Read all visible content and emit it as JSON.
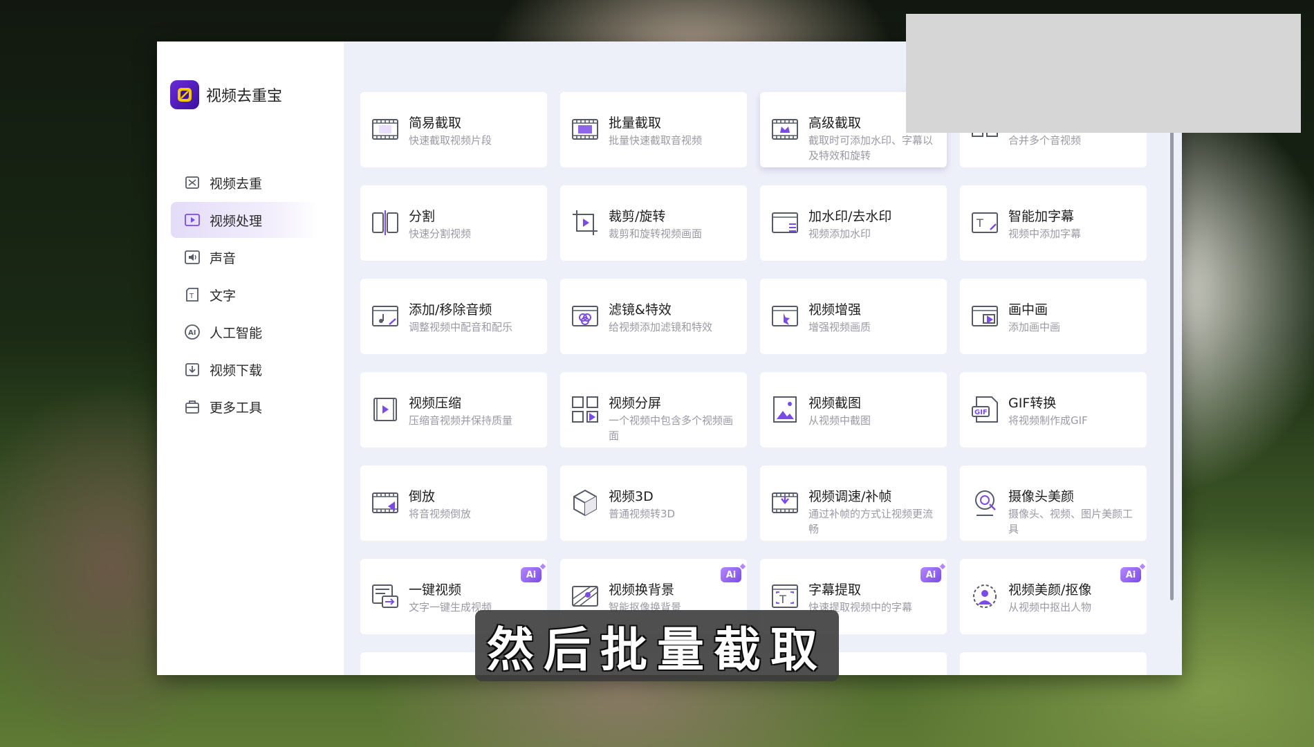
{
  "app": {
    "name": "视频去重宝"
  },
  "sidebar": {
    "items": [
      {
        "label": "视频去重",
        "icon": "dedup-icon",
        "active": false
      },
      {
        "label": "视频处理",
        "icon": "video-process-icon",
        "active": true
      },
      {
        "label": "声音",
        "icon": "sound-icon",
        "active": false
      },
      {
        "label": "文字",
        "icon": "text-icon",
        "active": false
      },
      {
        "label": "人工智能",
        "icon": "ai-icon",
        "active": false
      },
      {
        "label": "视频下载",
        "icon": "download-icon",
        "active": false
      },
      {
        "label": "更多工具",
        "icon": "toolbox-icon",
        "active": false
      }
    ]
  },
  "tools": [
    {
      "title": "简易截取",
      "desc": "快速截取视频片段",
      "icon": "film-cut-icon",
      "ai": false
    },
    {
      "title": "批量截取",
      "desc": "批量快速截取音视频",
      "icon": "film-batch-icon",
      "ai": false
    },
    {
      "title": "高级截取",
      "desc": "截取时可添加水印、字幕以及特效和旋转",
      "icon": "film-crown-icon",
      "ai": false
    },
    {
      "title": "",
      "desc": "合并多个音视频",
      "icon": "merge-icon",
      "ai": false
    },
    {
      "title": "分割",
      "desc": "快速分割视频",
      "icon": "split-icon",
      "ai": false
    },
    {
      "title": "裁剪/旋转",
      "desc": "裁剪和旋转视频画面",
      "icon": "crop-rotate-icon",
      "ai": false
    },
    {
      "title": "加水印/去水印",
      "desc": "视频添加水印",
      "icon": "watermark-icon",
      "ai": false
    },
    {
      "title": "智能加字幕",
      "desc": "视频中添加字幕",
      "icon": "subtitle-add-icon",
      "ai": false
    },
    {
      "title": "添加/移除音频",
      "desc": "调整视频中配音和配乐",
      "icon": "audio-icon",
      "ai": false
    },
    {
      "title": "滤镜&特效",
      "desc": "给视频添加滤镜和特效",
      "icon": "filter-icon",
      "ai": false
    },
    {
      "title": "视频增强",
      "desc": "增强视频画质",
      "icon": "enhance-icon",
      "ai": false
    },
    {
      "title": "画中画",
      "desc": "添加画中画",
      "icon": "pip-icon",
      "ai": false
    },
    {
      "title": "视频压缩",
      "desc": "压缩音视频并保持质量",
      "icon": "compress-icon",
      "ai": false
    },
    {
      "title": "视频分屏",
      "desc": "一个视频中包含多个视频画面",
      "icon": "split-screen-icon",
      "ai": false
    },
    {
      "title": "视频截图",
      "desc": "从视频中截图",
      "icon": "screenshot-icon",
      "ai": false
    },
    {
      "title": "GIF转换",
      "desc": "将视频制作成GIF",
      "icon": "gif-icon",
      "ai": false
    },
    {
      "title": "倒放",
      "desc": "将音视频倒放",
      "icon": "reverse-icon",
      "ai": false
    },
    {
      "title": "视频3D",
      "desc": "普通视频转3D",
      "icon": "cube-3d-icon",
      "ai": false
    },
    {
      "title": "视频调速/补帧",
      "desc": "通过补帧的方式让视频更流畅",
      "icon": "speed-icon",
      "ai": false
    },
    {
      "title": "摄像头美颜",
      "desc": "摄像头、视频、图片美颜工具",
      "icon": "camera-beauty-icon",
      "ai": false
    },
    {
      "title": "一键视频",
      "desc": "文字一键生成视频",
      "icon": "text-to-video-icon",
      "ai": true
    },
    {
      "title": "视频换背景",
      "desc": "智能抠像换背景",
      "icon": "background-icon",
      "ai": true
    },
    {
      "title": "字幕提取",
      "desc": "快速提取视频中的字幕",
      "icon": "subtitle-extract-icon",
      "ai": true
    },
    {
      "title": "视频美颜/抠像",
      "desc": "从视频中抠出人物",
      "icon": "portrait-cutout-icon",
      "ai": true
    },
    {
      "title": "",
      "desc": "",
      "icon": "",
      "ai": false
    },
    {
      "title": "",
      "desc": "",
      "icon": "",
      "ai": false
    },
    {
      "title": "",
      "desc": "",
      "icon": "",
      "ai": false
    },
    {
      "title": "",
      "desc": "",
      "icon": "",
      "ai": false
    }
  ],
  "ai_badge_label": "Ai",
  "caption": "然后批量截取",
  "colors": {
    "accent": "#7a4be8",
    "brand": "#5a1fc4",
    "content_bg": "#eef0f9"
  }
}
